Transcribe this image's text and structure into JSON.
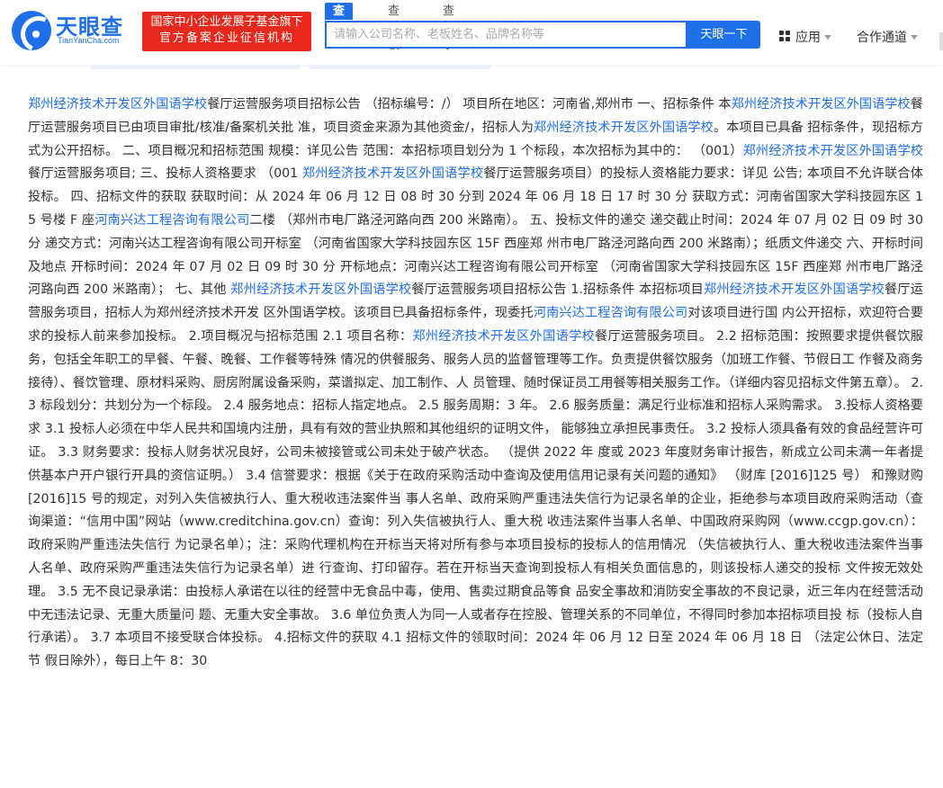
{
  "header": {
    "logo_text": "天眼查",
    "logo_sub": "TianYanCha.com",
    "badge_line1": "国家中小企业发展子基金旗下",
    "badge_line2": "官方备案企业征信机构",
    "tabs": [
      {
        "label": "查公司",
        "active": true
      },
      {
        "label": "查老板",
        "active": false
      },
      {
        "label": "查关系",
        "active": false
      }
    ],
    "search_placeholder": "请输入公司名称、老板姓名、品牌名称等",
    "search_button": "天眼一下",
    "nav_apps": "应用",
    "nav_partner": "合作通道"
  },
  "colors": {
    "brand_blue": "#1f6fe8",
    "badge_red": "#e8281c"
  },
  "article": {
    "segments": [
      {
        "text": "郑州经济技术开发区外国语学校",
        "link": true
      },
      {
        "text": "餐厅运营服务项目招标公告 （招标编号：/） 项目所在地区：河南省,郑州市 一、招标条件 本",
        "link": false
      },
      {
        "text": "郑州经济技术开发区外国语学校",
        "link": true
      },
      {
        "text": "餐厅运营服务项目已由项目审批/核准/备案机关批 准，项目资金来源为其他资金/，招标人为",
        "link": false
      },
      {
        "text": "郑州经济技术开发区外国语学校",
        "link": true
      },
      {
        "text": "。本项目已具备 招标条件，现招标方式为公开招标。 二、项目概况和招标范围 规模：详见公告 范围：本招标项目划分为 1 个标段，本次招标为其中的： （001）",
        "link": false
      },
      {
        "text": "郑州经济技术开发区外国语学校",
        "link": true
      },
      {
        "text": "餐厅运营服务项目; 三、投标人资格要求 （001 ",
        "link": false
      },
      {
        "text": "郑州经济技术开发区外国语学校",
        "link": true
      },
      {
        "text": "餐厅运营服务项目）的投标人资格能力要求：详见 公告; 本项目不允许联合体投标。 四、招标文件的获取 获取时间：从 2024 年 06 月 12 日 08 时 30 分到 2024 年 06 月 18 日 17 时 30 分 获取方式：河南省国家大学科技园东区 15 号楼 F 座",
        "link": false
      },
      {
        "text": "河南兴达工程咨询有限公司",
        "link": true
      },
      {
        "text": "二楼 （郑州市电厂路泾河路向西 200 米路南）。 五、投标文件的递交 递交截止时间：2024 年 07 月 02 日 09 时 30 分 递交方式：河南兴达工程咨询有限公司开标室 （河南省国家大学科技园东区 15F 西座郑 州市电厂路泾河路向西 200 米路南）；纸质文件递交 六、开标时间及地点 开标时间：2024 年 07 月 02 日 09 时 30 分 开标地点：河南兴达工程咨询有限公司开标室 （河南省国家大学科技园东区 15F 西座郑 州市电厂路泾河路向西 200 米路南）； 七、其他 ",
        "link": false
      },
      {
        "text": "郑州经济技术开发区外国语学校",
        "link": true
      },
      {
        "text": "餐厅运营服务项目招标公告 1.招标条件 本招标项目",
        "link": false
      },
      {
        "text": "郑州经济技术开发区外国语学校",
        "link": true
      },
      {
        "text": "餐厅运营服务项目，招标人为郑州经济技术开发 区外国语学校。该项目已具备招标条件，现委托",
        "link": false
      },
      {
        "text": "河南兴达工程咨询有限公司",
        "link": true
      },
      {
        "text": "对该项目进行国 内公开招标，欢迎符合要求的投标人前来参加投标。 2.项目概况与招标范围 2.1 项目名称：",
        "link": false
      },
      {
        "text": "郑州经济技术开发区外国语学校",
        "link": true
      },
      {
        "text": "餐厅运营服务项目。 2.2 招标范围：按照要求提供餐饮服务，包括全年职工的早餐、午餐、晚餐、工作餐等特殊 情况的供餐服务、服务人员的监督管理等工作。负责提供餐饮服务（加班工作餐、节假日工 作餐及商务接待）、餐饮管理、原材料采购、厨房附属设备采购，菜谱拟定、加工制作、人 员管理、随时保证员工用餐等相关服务工作。（详细内容见招标文件第五章）。 2.3 标段划分：共划分为一个标段。 2.4 服务地点：招标人指定地点。 2.5 服务周期：3 年。 2.6 服务质量：满足行业标准和招标人采购需求。 3.投标人资格要求 3.1 投标人必须在中华人民共和国境内注册，具有有效的营业执照和其他组织的证明文件， 能够独立承担民事责任。 3.2 投标人须具备有效的食品经营许可证。 3.3 财务要求：投标人财务状况良好，公司未被接管或公司未处于破产状态。 （提供 2022 年 度或 2023 年度财务审计报告，新成立公司未满一年者提供基本户开户银行开具的资信证明。） 3.4 信誉要求：根据《关于在政府采购活动中查询及使用信用记录有关问题的通知》 （财库 [2016]125 号） 和豫财购[2016]15 号的规定，对列入失信被执行人、重大税收违法案件当 事人名单、政府采购严重违法失信行为记录名单的企业，拒绝参与本项目政府采购活动（查 询渠道：“信用中国”网站（www.creditchina.gov.cn）查询：列入失信被执行人、重大税 收违法案件当事人名单、中国政府采购网（www.ccgp.gov.cn）：政府采购严重违法失信行 为记录名单）；注：采购代理机构在开标当天将对所有参与本项目投标的投标人的信用情况 （失信被执行人、重大税收违法案件当事人名单、政府采购严重违法失信行为记录名单）进 行查询、打印留存。若在开标当天查询到投标人有相关负面信息的，则该投标人递交的投标 文件按无效处理。 3.5 无不良记录承诺：由投标人承诺在以往的经营中无食品中毒，使用、售卖过期食品等食 品安全事故和消防安全事故的不良记录，近三年内在经营活动中无违法记录、无重大质量问 题、无重大安全事故。 3.6 单位负责人为同一人或者存在控股、管理关系的不同单位，不得同时参加本招标项目投 标（投标人自行承诺）。 3.7 本项目不接受联合体投标。 4.招标文件的获取 4.1 招标文件的领取时间：2024 年 06 月 12 日至 2024 年 06 月 18 日 （法定公休日、法定节 假日除外），每日上午 8：30",
        "link": false
      }
    ]
  }
}
